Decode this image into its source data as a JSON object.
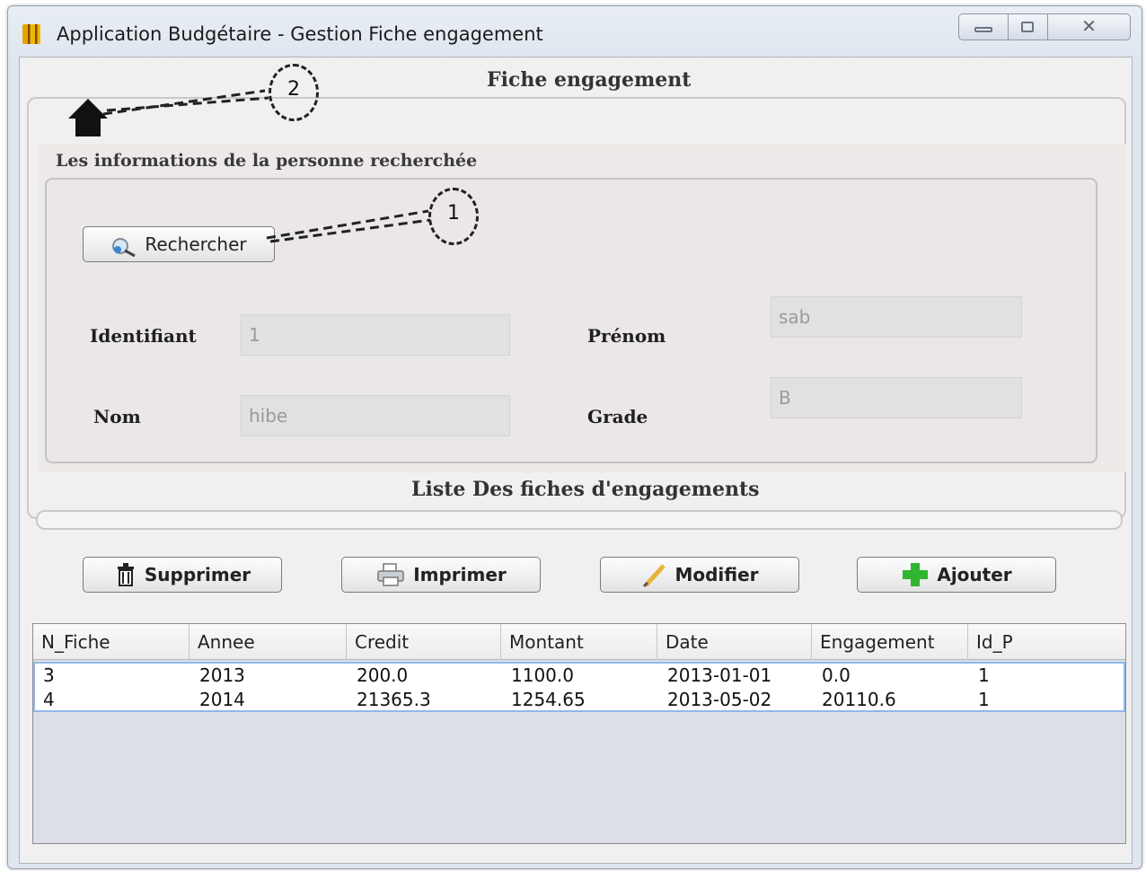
{
  "window": {
    "title": "Application Budgétaire - Gestion Fiche engagement",
    "controls": {
      "minimize": "",
      "maximize": "",
      "close": "✕"
    }
  },
  "form": {
    "title": "Fiche engagement",
    "home_icon": "home-icon",
    "info_section_title": "Les informations de la personne recherchée",
    "search_button": "Rechercher",
    "fields": {
      "identifiant": {
        "label": "Identifiant",
        "value": "1"
      },
      "nom": {
        "label": "Nom",
        "value": "hibe"
      },
      "prenom": {
        "label": "Prénom",
        "value": "sab"
      },
      "grade": {
        "label": "Grade",
        "value": "B"
      }
    },
    "list_title": "Liste Des fiches d'engagements",
    "actions": {
      "delete": "Supprimer",
      "print": "Imprimer",
      "edit": "Modifier",
      "add": "Ajouter"
    }
  },
  "table": {
    "columns": [
      "N_Fiche",
      "Annee",
      "Credit",
      "Montant",
      "Date",
      "Engagement",
      "Id_P"
    ],
    "rows": [
      [
        "3",
        "2013",
        "200.0",
        "1100.0",
        "2013-01-01",
        "0.0",
        "1"
      ],
      [
        "4",
        "2014",
        "21365.3",
        "1254.65",
        "2013-05-02",
        "20110.6",
        "1"
      ]
    ]
  },
  "callouts": {
    "first": "1",
    "second": "2"
  },
  "colors": {
    "selection_border": "#8fb8e8",
    "add_icon": "#2fb52f",
    "panel": "#ece9e8"
  }
}
